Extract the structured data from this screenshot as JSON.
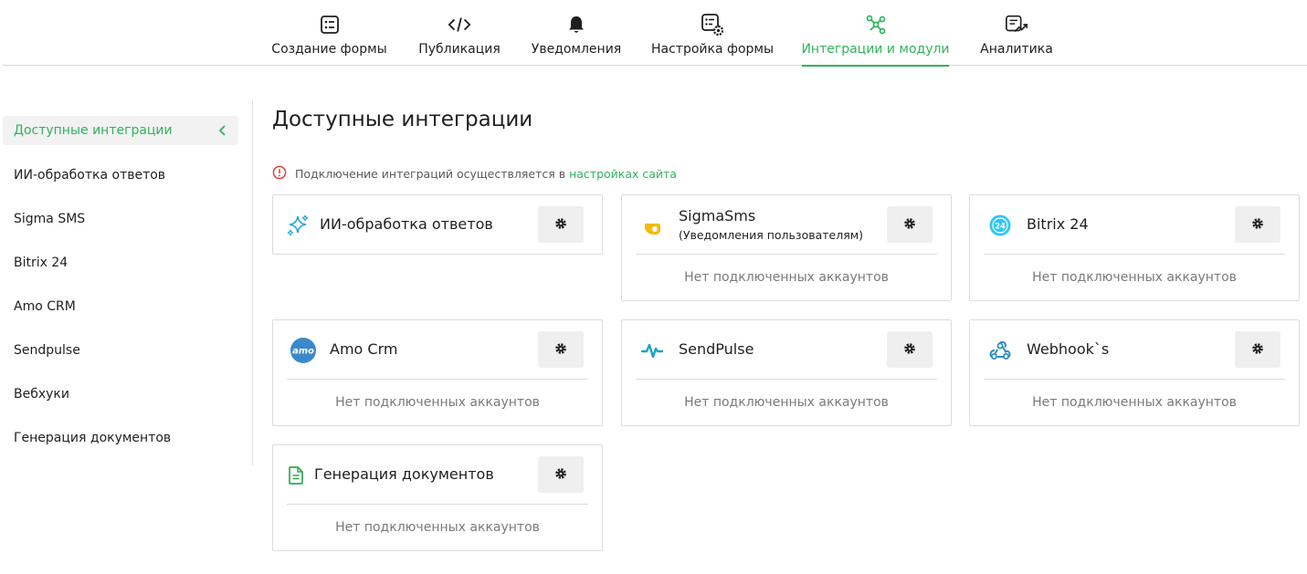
{
  "nav": {
    "tabs": [
      {
        "label": "Создание формы",
        "icon": "form-list-icon"
      },
      {
        "label": "Публикация",
        "icon": "code-icon"
      },
      {
        "label": "Уведомления",
        "icon": "bell-icon"
      },
      {
        "label": "Настройка формы",
        "icon": "form-settings-icon"
      },
      {
        "label": "Интеграции и модули",
        "icon": "integrations-icon",
        "active": true
      },
      {
        "label": "Аналитика",
        "icon": "analytics-icon"
      }
    ]
  },
  "sidebar": {
    "items": [
      {
        "label": "Доступные интеграции",
        "active": true
      },
      {
        "label": "ИИ-обработка ответов"
      },
      {
        "label": "Sigma SMS"
      },
      {
        "label": "Bitrix 24"
      },
      {
        "label": "Amo CRM"
      },
      {
        "label": "Sendpulse"
      },
      {
        "label": "Вебхуки"
      },
      {
        "label": "Генерация документов"
      }
    ]
  },
  "main": {
    "title": "Доступные интеграции",
    "notice": {
      "text": "Подключение интеграций осуществляется в",
      "link": "настройках сайта"
    },
    "empty_text": "Нет подключенных аккаунтов",
    "cards": [
      {
        "title": "ИИ-обработка ответов",
        "icon": "sparkles-icon"
      },
      {
        "title": "SigmaSms",
        "subtitle": "(Уведомления пользователям)",
        "icon": "sigmasms-logo-icon",
        "body": "Нет подключенных аккаунтов"
      },
      {
        "title": "Bitrix 24",
        "icon": "bitrix24-logo-icon",
        "body": "Нет подключенных аккаунтов"
      },
      {
        "title": "Amo Crm",
        "icon": "amocrm-logo-icon",
        "logo_text": "amo",
        "body": "Нет подключенных аккаунтов"
      },
      {
        "title": "SendPulse",
        "icon": "sendpulse-logo-icon",
        "body": "Нет подключенных аккаунтов"
      },
      {
        "title": "Webhook`s",
        "icon": "webhook-icon",
        "body": "Нет подключенных аккаунтов"
      },
      {
        "title": "Генерация документов",
        "icon": "document-icon",
        "body": "Нет подключенных аккаунтов"
      }
    ]
  },
  "colors": {
    "accent": "#2fb45a",
    "notice_icon": "#e0433c",
    "bitrix": "#2fc7f7",
    "amocrm": "#3a89c9",
    "sendpulse": "#1aa3c8",
    "sigmasms": "#f5b90a"
  }
}
